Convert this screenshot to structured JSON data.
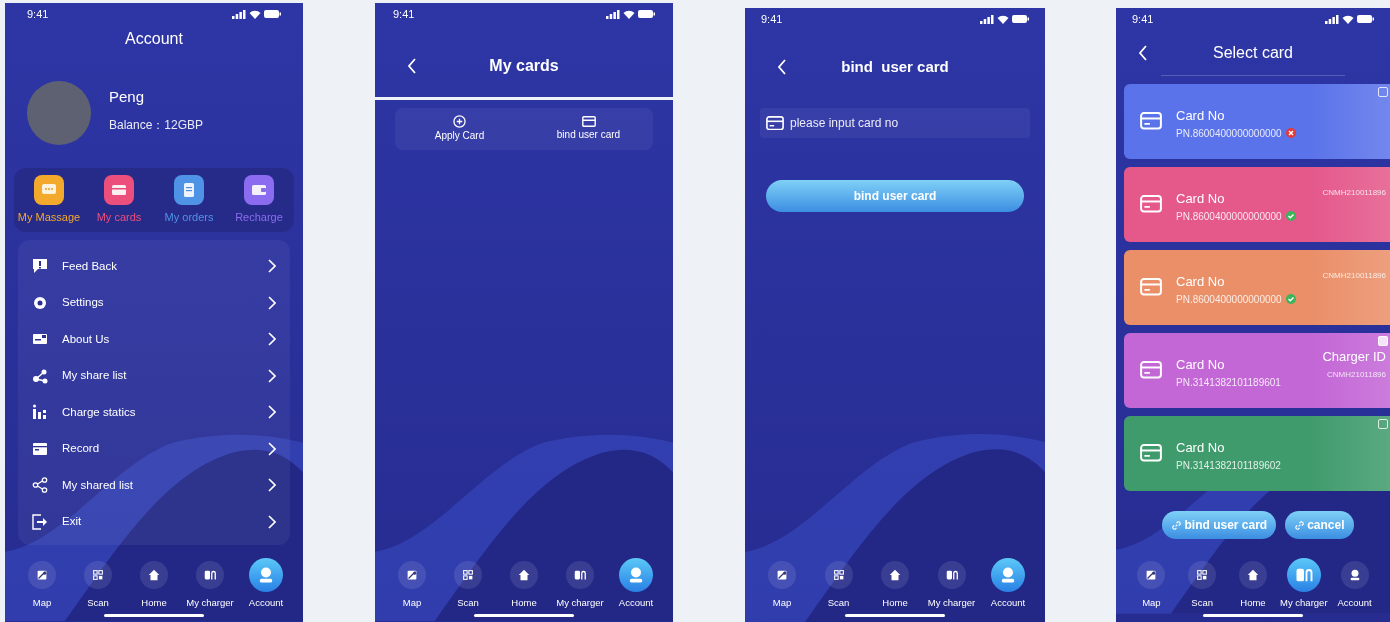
{
  "screens": [
    {
      "kind": "account",
      "status_bar": {
        "time": "9:41"
      },
      "title": "Account",
      "profile": {
        "name": "Peng",
        "balance": "Balance：12GBP"
      },
      "shortcuts": [
        {
          "label": "My Massage",
          "color": "#f2a92c"
        },
        {
          "label": "My cards",
          "color": "#ec4f7c"
        },
        {
          "label": "My orders",
          "color": "#4f93e6"
        },
        {
          "label": "Recharge",
          "color": "#8b6cf0"
        }
      ],
      "menu": [
        "Feed Back",
        "Settings",
        "About Us",
        "My share list",
        "Charge statics",
        "Record",
        "My shared list",
        "Exit"
      ],
      "tab_bar": [
        {
          "label": "Map",
          "selected": false
        },
        {
          "label": "Scan",
          "selected": false
        },
        {
          "label": "Home",
          "selected": false
        },
        {
          "label": "My charger",
          "selected": false
        },
        {
          "label": "Account",
          "selected": true
        }
      ]
    },
    {
      "kind": "my_cards",
      "status_bar": {
        "time": "9:41"
      },
      "title": "My cards",
      "actions": [
        "Apply Card",
        "bind user card"
      ],
      "tab_bar": [
        {
          "label": "Map",
          "selected": false
        },
        {
          "label": "Scan",
          "selected": false
        },
        {
          "label": "Home",
          "selected": false
        },
        {
          "label": "My charger",
          "selected": false
        },
        {
          "label": "Account",
          "selected": true
        }
      ]
    },
    {
      "kind": "bind_card",
      "status_bar": {
        "time": "9:41"
      },
      "title": "bind  user card",
      "card_input": {
        "placeholder": "please input card no"
      },
      "submit_button": "bind user card",
      "tab_bar": [
        {
          "label": "Map",
          "selected": false
        },
        {
          "label": "Scan",
          "selected": false
        },
        {
          "label": "Home",
          "selected": false
        },
        {
          "label": "My charger",
          "selected": false
        },
        {
          "label": "Account",
          "selected": true
        }
      ]
    },
    {
      "kind": "select_card",
      "status_bar": {
        "time": "9:41"
      },
      "title": "Select card",
      "cards": [
        {
          "label": "Card No",
          "number": "PN.8600400000000000",
          "valid": false,
          "checkbox": {
            "checked": false
          },
          "color": "#5b73ea"
        },
        {
          "label": "Card No",
          "number": "PN.8600400000000000",
          "valid": true,
          "charger_id": "CNMH210011896",
          "color": "#e4588a"
        },
        {
          "label": "Card No",
          "number": "PN.8600400000000000",
          "valid": true,
          "charger_id": "CNMH210011896",
          "color": "#ea8f68"
        },
        {
          "label": "Card No",
          "number": "PN.3141382101189601",
          "charger_label": "Charger ID",
          "charger_id": "CNMH21011896",
          "checkbox": {
            "checked": true
          },
          "color": "#c366d6"
        },
        {
          "label": "Card No",
          "number": "PN.3141382101189602",
          "checkbox": {
            "checked": false
          },
          "color": "#3f9b6c"
        }
      ],
      "buttons": [
        "bind user card",
        "cancel"
      ],
      "tab_bar": [
        {
          "label": "Map",
          "selected": false
        },
        {
          "label": "Scan",
          "selected": false
        },
        {
          "label": "Home",
          "selected": false
        },
        {
          "label": "My charger",
          "selected": true
        },
        {
          "label": "Account",
          "selected": false
        }
      ]
    }
  ]
}
